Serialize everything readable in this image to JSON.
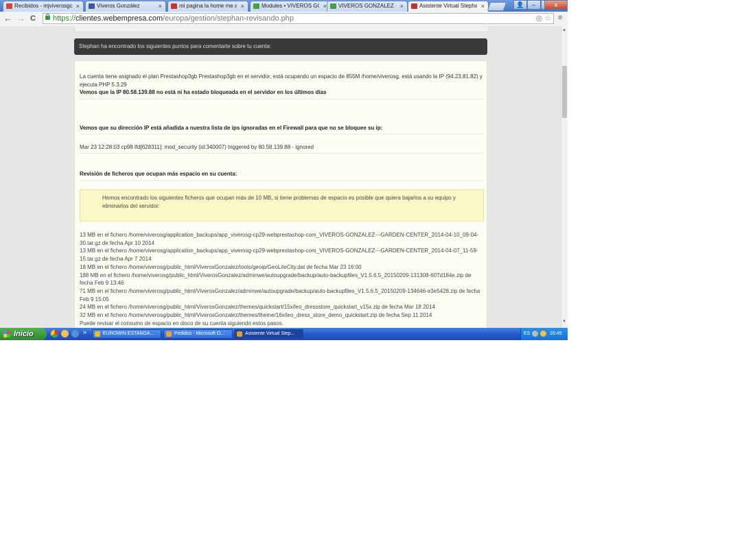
{
  "browser": {
    "tabs": [
      {
        "label": "Recibidos - mjviverosgonz",
        "favicon_color": "#d44638"
      },
      {
        "label": "Viveros González",
        "favicon_color": "#3b5998"
      },
      {
        "label": "mi pagina la home me apa",
        "favicon_color": "#c2352b"
      },
      {
        "label": "Modules • VIVEROS GONZ",
        "favicon_color": "#47a047"
      },
      {
        "label": "VIVEROS GONZALEZ - GAR",
        "favicon_color": "#47a047"
      },
      {
        "label": "Asistente Virtual Stephan",
        "favicon_color": "#c2352b"
      }
    ],
    "tab_close": "×",
    "window_controls": {
      "user": "👤",
      "minimize": "–",
      "maximize": "▫",
      "close": "x"
    },
    "url": {
      "scheme": "https://",
      "host": "clientes.webempresa.com",
      "path": "/europa/gestion/stephan-revisando.php"
    },
    "nav": {
      "back": "←",
      "forward": "→",
      "reload": "C"
    },
    "omnibox_icons": "◎ ☆",
    "menu": "≡"
  },
  "page": {
    "header": "Stephan ha encontrado los siguientes puntos para comentarte sobre tu cuenta:",
    "account_info": "La cuenta tiene asignado el plan Prestashop3gb Prestashop3gb en el servidor, está ocupando un espacio de 855M /home/viverosg, está usando la IP (94.23.81.82) y ejecuta PHP 5.3.29",
    "ip_status": "Vemos que la IP 80.58.139.88 no está ni ha estado bloqueada en el servidor en los últimos días",
    "firewall_title": "Vemos que su dirección IP está añadida a nuestra lista de ips ignoradas en el Firewall para que no se bloquee su ip:",
    "firewall_log": "Mar 23 12:28:03 cp98 lfd[628311]: mod_security (id:340007) triggered by 80.58.139.88 - ignored",
    "files_title": "Revisión de ficheros que ocupan más espacio en su cuenta:",
    "files_notice": "Hemos encontrado los siguientes ficheros que ocupan más de 10 MB, si tiene problemas de espacio es posible que quiera bajarlos a su equipo y eliminarlos del servidor:",
    "files": [
      "13 MB en el fichero /home/viverosg/application_backups/app_viverosg-cp29-webprestashop-com_VIVEROS-GONZALEZ---GARDEN-CENTER_2014-04-10_09-04-30.tar.gz de fecha Apr 10 2014",
      "13 MB en el fichero /home/viverosg/application_backups/app_viverosg-cp29-webprestashop-com_VIVEROS-GONZALEZ---GARDEN-CENTER_2014-04-07_11-59-15.tar.gz de fecha Apr 7 2014",
      "18 MB en el fichero /home/viverosg/public_html/ViverosGonzalez/tools/geoip/GeoLiteCity.dat de fecha Mar 23 16:00",
      "188 MB en el fichero /home/viverosg/public_html/ViverosGonzalez/adminwe/autoupgrade/backup/auto-backupfiles_V1.5.6.5_20150209-131308-607d184e.zip de fecha Feb 9 13:46",
      "71 MB en el fichero /home/viverosg/public_html/ViverosGonzalez/adminwe/autoupgrade/backup/auto-backupfiles_V1.5.6.5_20150209-134646-e3e5428.zip de fecha Feb 9 15:05",
      "24 MB en el fichero /home/viverosg/public_html/ViverosGonzalez/themes/quickstart/15x/leo_dressstore_quickstart_v15x.zip de fecha Mar 18 2014",
      "32 MB en el fichero /home/viverosg/public_html/ViverosGonzalez/themes/theme/16x/leo_dress_store_demo_quickstart.zip de fecha Sep 11 2014",
      "Puede revisar el consumo de espacio en disco de su cuenta siguiendo estos pasos."
    ]
  },
  "taskbar": {
    "start": "Inicio",
    "overflow": "»",
    "items": [
      {
        "label": "EUROWIN ESTANDA...",
        "icon_color": "#e8c020",
        "active": false
      },
      {
        "label": "Pedidos - Microsoft O...",
        "icon_color": "#f0a030",
        "active": false
      },
      {
        "label": "Asistente Virtual Step...",
        "icon_color": "#e0a020",
        "active": true
      }
    ],
    "tray": {
      "lang": "ES",
      "time": "16:45"
    }
  }
}
